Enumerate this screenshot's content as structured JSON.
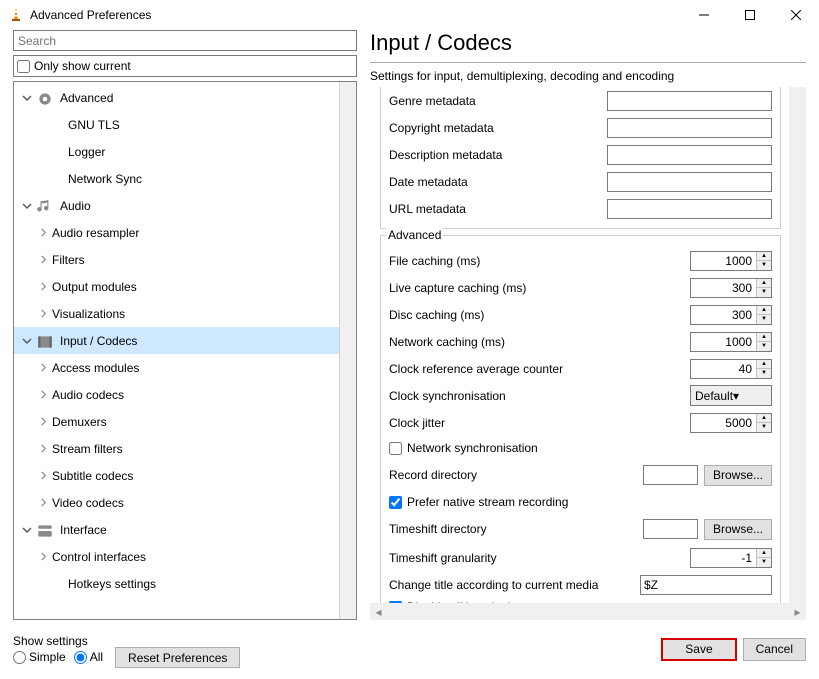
{
  "window": {
    "title": "Advanced Preferences"
  },
  "left": {
    "searchPlaceholder": "Search",
    "onlyCurrent": "Only show current",
    "tree": [
      {
        "t": "cat",
        "label": "Advanced",
        "icon": "gear",
        "exp": true
      },
      {
        "t": "leaf",
        "label": "GNU TLS",
        "d": 2
      },
      {
        "t": "leaf",
        "label": "Logger",
        "d": 2
      },
      {
        "t": "leaf",
        "label": "Network Sync",
        "d": 2
      },
      {
        "t": "cat",
        "label": "Audio",
        "icon": "audio",
        "exp": true
      },
      {
        "t": "sub",
        "label": "Audio resampler",
        "d": 2
      },
      {
        "t": "sub",
        "label": "Filters",
        "d": 2
      },
      {
        "t": "sub",
        "label": "Output modules",
        "d": 2
      },
      {
        "t": "sub",
        "label": "Visualizations",
        "d": 2
      },
      {
        "t": "cat",
        "label": "Input / Codecs",
        "icon": "codec",
        "exp": true,
        "sel": true
      },
      {
        "t": "sub",
        "label": "Access modules",
        "d": 2
      },
      {
        "t": "sub",
        "label": "Audio codecs",
        "d": 2
      },
      {
        "t": "sub",
        "label": "Demuxers",
        "d": 2
      },
      {
        "t": "sub",
        "label": "Stream filters",
        "d": 2
      },
      {
        "t": "sub",
        "label": "Subtitle codecs",
        "d": 2
      },
      {
        "t": "sub",
        "label": "Video codecs",
        "d": 2
      },
      {
        "t": "cat",
        "label": "Interface",
        "icon": "iface",
        "exp": true
      },
      {
        "t": "sub",
        "label": "Control interfaces",
        "d": 2
      },
      {
        "t": "leaf",
        "label": "Hotkeys settings",
        "d": 2
      }
    ]
  },
  "page": {
    "heading": "Input / Codecs",
    "description": "Settings for input, demultiplexing, decoding and encoding",
    "meta": {
      "genre": "Genre metadata",
      "copyright": "Copyright metadata",
      "descr": "Description metadata",
      "date": "Date metadata",
      "url": "URL metadata"
    },
    "adv": {
      "groupTitle": "Advanced",
      "fileCache": {
        "label": "File caching (ms)",
        "val": "1000"
      },
      "liveCache": {
        "label": "Live capture caching (ms)",
        "val": "300"
      },
      "discCache": {
        "label": "Disc caching (ms)",
        "val": "300"
      },
      "netCache": {
        "label": "Network caching (ms)",
        "val": "1000"
      },
      "clockRef": {
        "label": "Clock reference average counter",
        "val": "40"
      },
      "clockSync": {
        "label": "Clock synchronisation",
        "val": "Default"
      },
      "clockJitter": {
        "label": "Clock jitter",
        "val": "5000"
      },
      "netSync": {
        "label": "Network synchronisation"
      },
      "recDir": {
        "label": "Record directory",
        "browse": "Browse..."
      },
      "prefNative": {
        "label": "Prefer native stream recording"
      },
      "tsDir": {
        "label": "Timeshift directory",
        "browse": "Browse..."
      },
      "tsGran": {
        "label": "Timeshift granularity",
        "val": "-1"
      },
      "changeTitle": {
        "label": "Change title according to current media",
        "val": "$Z"
      },
      "disableLua": {
        "label": "Disable all lua plugins"
      }
    }
  },
  "bottom": {
    "showSettings": "Show settings",
    "simple": "Simple",
    "all": "All",
    "reset": "Reset Preferences",
    "save": "Save",
    "cancel": "Cancel"
  }
}
